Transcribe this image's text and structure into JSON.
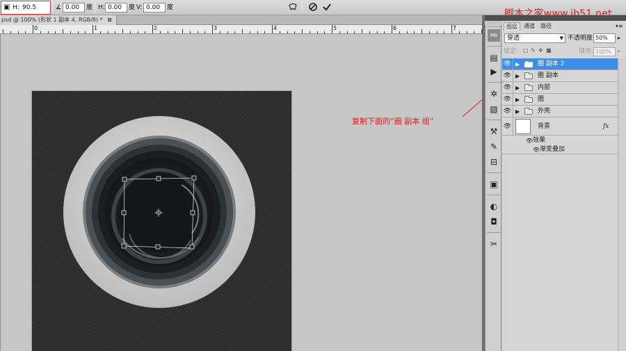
{
  "options_bar": {
    "h_field_label": "H:",
    "h_field_value": "90.5",
    "angle_value": "0.00",
    "angle_unit": "度",
    "hskew_label": "H:",
    "hskew_value": "0.00",
    "hskew_unit": "度",
    "vskew_label": "V:",
    "vskew_value": "0.00",
    "vskew_unit": "度"
  },
  "document": {
    "tab_title": "psd @ 100% (形状 1 副本 4, RGB/8) *"
  },
  "ruler": {
    "labels": [
      "0",
      "1",
      "2",
      "3",
      "4",
      "5",
      "6",
      "7"
    ]
  },
  "watermark": "脚本之家www.jb51.net",
  "annotation": "复制下面的“圈 副本 组”",
  "layers_panel": {
    "tabs": [
      "图层",
      "通道",
      "路径"
    ],
    "blend_mode": "穿透",
    "opacity_label": "不透明度:",
    "opacity_value": "50%",
    "lock_label": "锁定:",
    "fill_label": "填充:",
    "fill_value": "100%",
    "layers": [
      {
        "name": "圈 副本 2",
        "selected": true
      },
      {
        "name": "圈 副本",
        "selected": false
      },
      {
        "name": "内部",
        "selected": false
      },
      {
        "name": "圈",
        "selected": false
      },
      {
        "name": "外壳",
        "selected": false
      }
    ],
    "background": {
      "name": "背景",
      "fx": "fx",
      "effects_label": "效果",
      "effect_item": "渐变叠加"
    }
  },
  "colors": {
    "accent_selection": "#3d8ee6",
    "annotation_red": "#e02020",
    "canvas_bg": "#2d2d2d"
  }
}
